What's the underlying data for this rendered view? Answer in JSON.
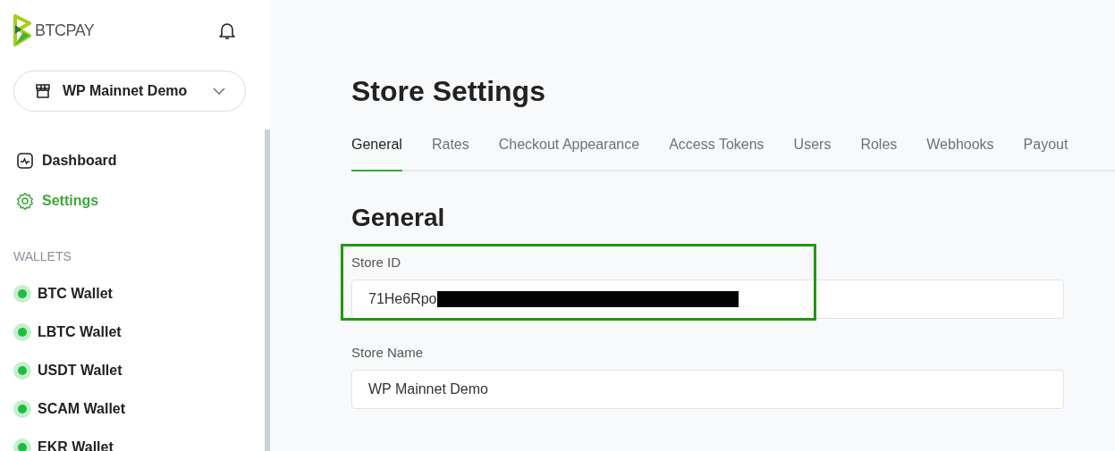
{
  "brand": {
    "name": "BTCPAY"
  },
  "store_selector": {
    "label": "WP Mainnet Demo"
  },
  "nav": [
    {
      "label": "Dashboard",
      "kind": "dashboard",
      "selected": false
    },
    {
      "label": "Settings",
      "kind": "settings",
      "selected": true
    }
  ],
  "wallets_heading": "WALLETS",
  "wallets": [
    {
      "label": "BTC Wallet",
      "color": "#1dbe3f"
    },
    {
      "label": "LBTC Wallet",
      "color": "#1dbe3f"
    },
    {
      "label": "USDT Wallet",
      "color": "#1dbe3f"
    },
    {
      "label": "SCAM Wallet",
      "color": "#1dbe3f"
    },
    {
      "label": "EKR Wallet",
      "color": "#1dbe3f"
    }
  ],
  "page_title": "Store Settings",
  "tabs": [
    {
      "label": "General",
      "selected": true
    },
    {
      "label": "Rates",
      "selected": false
    },
    {
      "label": "Checkout Appearance",
      "selected": false
    },
    {
      "label": "Access Tokens",
      "selected": false
    },
    {
      "label": "Users",
      "selected": false
    },
    {
      "label": "Roles",
      "selected": false
    },
    {
      "label": "Webhooks",
      "selected": false
    },
    {
      "label": "Payout",
      "selected": false
    }
  ],
  "section_title": "General",
  "fields": [
    {
      "label": "Store ID",
      "value": "71He6Rpo",
      "redacted": true,
      "highlighted": true
    },
    {
      "label": "Store Name",
      "value": "WP Mainnet Demo",
      "redacted": false,
      "highlighted": false
    }
  ]
}
